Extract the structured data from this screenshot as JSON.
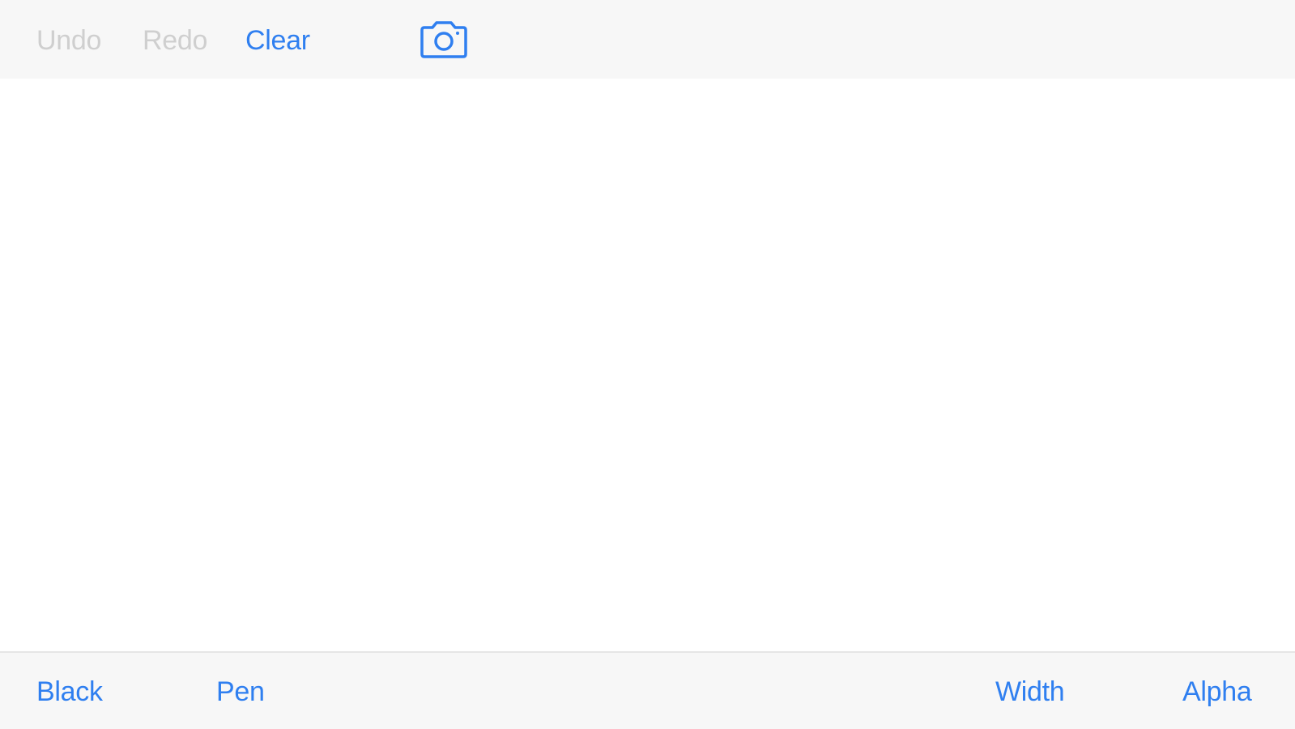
{
  "top_toolbar": {
    "undo_label": "Undo",
    "redo_label": "Redo",
    "clear_label": "Clear",
    "camera_icon": "camera-icon"
  },
  "bottom_toolbar": {
    "color_label": "Black",
    "tool_label": "Pen",
    "width_label": "Width",
    "alpha_label": "Alpha"
  },
  "colors": {
    "accent": "#2f7ff0",
    "disabled": "#cfcfcf",
    "toolbar_bg": "#f7f7f7",
    "canvas_bg": "#ffffff"
  }
}
